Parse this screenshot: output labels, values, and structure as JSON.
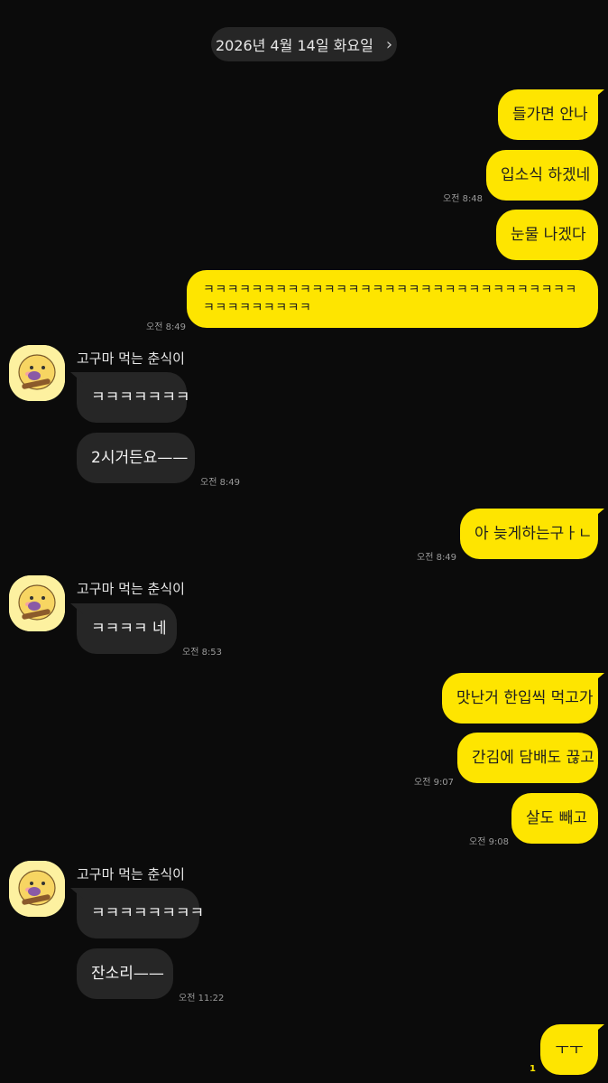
{
  "header": {
    "date": "2026년 4월 14일 화요일",
    "chevron_icon": "chevron-right-icon"
  },
  "colors": {
    "background": "#0b0b0b",
    "outgoing": "#fee500",
    "incoming": "#262626"
  },
  "sender_name": "고구마 먹는 춘식이",
  "messages": [
    {
      "dir": "out",
      "text": "들가면 안나"
    },
    {
      "dir": "out",
      "text": "입소식 하겠네",
      "time": "오전 8:48"
    },
    {
      "dir": "out",
      "text": "눈물 나겠다"
    },
    {
      "dir": "out",
      "text": "ㅋㅋㅋㅋㅋㅋㅋㅋㅋㅋㅋㅋㅋㅋㅋㅋㅋㅋㅋㅋㅋㅋㅋㅋㅋㅋㅋㅋㅋㅋㅋㅋㅋㅋㅋㅋㅋㅋㅋㅋ",
      "time": "오전 8:49"
    },
    {
      "dir": "in",
      "text": "ㅋㅋㅋㅋㅋㅋㅋ"
    },
    {
      "dir": "in",
      "text": "2시거든요——",
      "time": "오전 8:49"
    },
    {
      "dir": "out",
      "text": "아 늦게하는구ㅏㄴ",
      "time": "오전 8:49"
    },
    {
      "dir": "in",
      "text": "ㅋㅋㅋㅋ 네",
      "time": "오전 8:53"
    },
    {
      "dir": "out",
      "text": "맛난거 한입씩 먹고가"
    },
    {
      "dir": "out",
      "text": "간김에 담배도 끊고",
      "time": "오전 9:07"
    },
    {
      "dir": "out",
      "text": "살도 빼고",
      "time": "오전 9:08"
    },
    {
      "dir": "in",
      "text": "ㅋㅋㅋㅋㅋㅋㅋㅋ"
    },
    {
      "dir": "in",
      "text": "잔소리——",
      "time": "오전 11:22"
    },
    {
      "dir": "out",
      "text": "ㅜㅜ",
      "unread": "1"
    }
  ]
}
